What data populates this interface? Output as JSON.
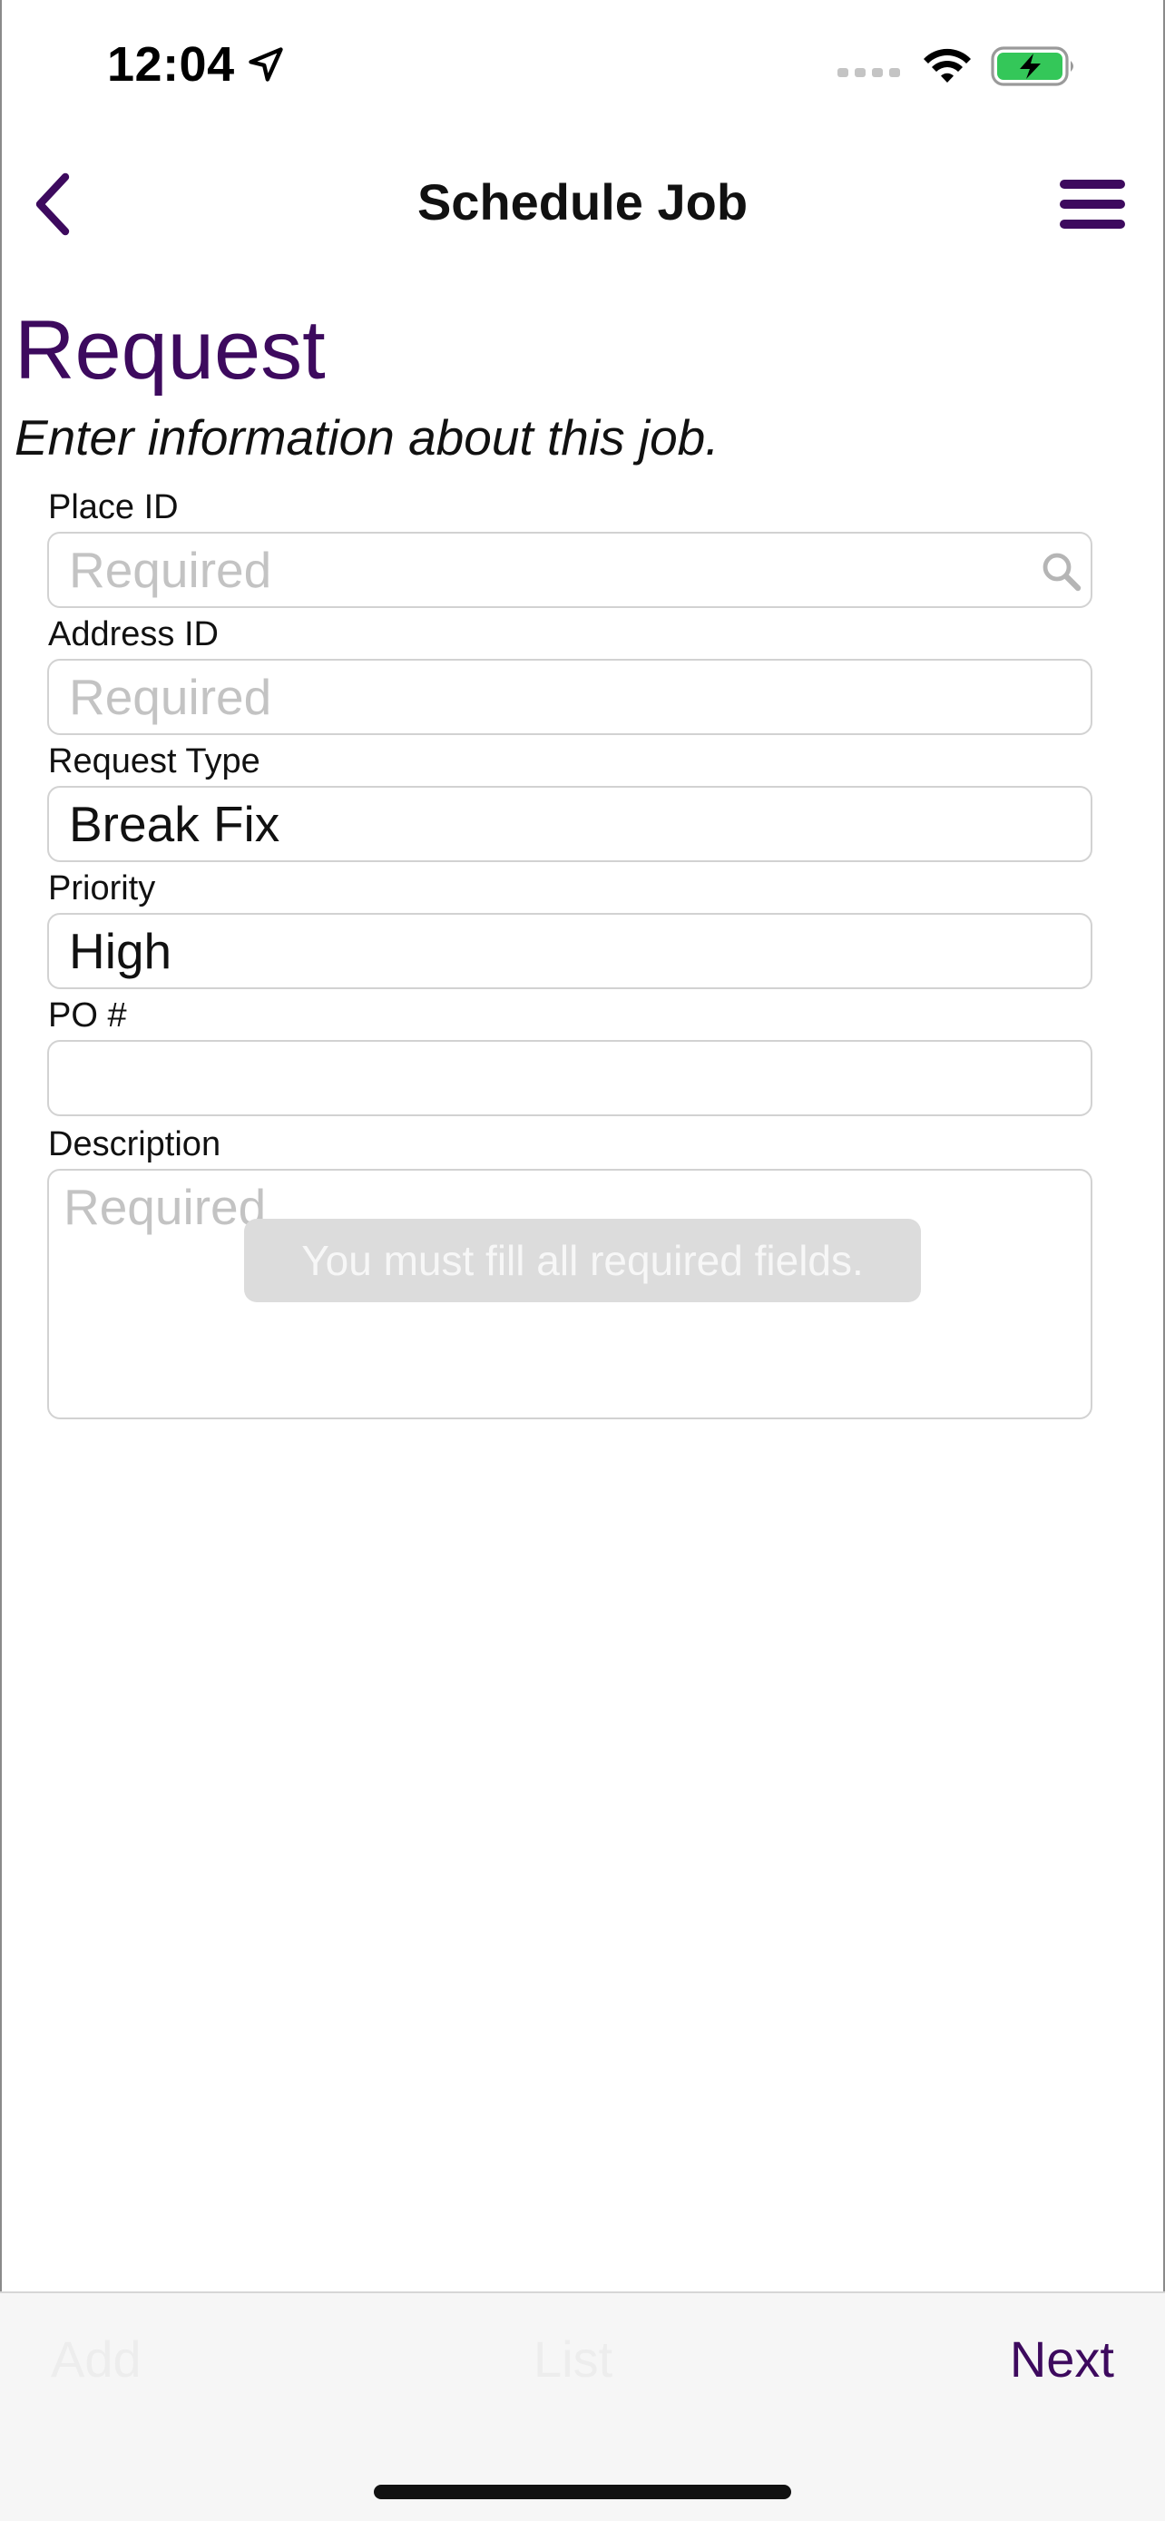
{
  "status_bar": {
    "time": "12:04",
    "icons": [
      "location-arrow-icon",
      "cellular-signal-icon",
      "wifi-icon",
      "battery-charging-icon"
    ],
    "battery_color": "#34c759"
  },
  "nav": {
    "title": "Schedule Job",
    "back_icon": "chevron-left-icon",
    "menu_icon": "hamburger-menu-icon",
    "accent_color": "#3d0a5e"
  },
  "header": {
    "heading": "Request",
    "subheading": "Enter information about this job."
  },
  "form": {
    "place_id": {
      "label": "Place ID",
      "value": "",
      "placeholder": "Required",
      "icon": "search-icon"
    },
    "address_id": {
      "label": "Address ID",
      "value": "",
      "placeholder": "Required"
    },
    "request_type": {
      "label": "Request Type",
      "value": "Break Fix"
    },
    "priority": {
      "label": "Priority",
      "value": "High"
    },
    "po_number": {
      "label": "PO #",
      "value": ""
    },
    "description": {
      "label": "Description",
      "value": "",
      "placeholder": "Required"
    }
  },
  "toast": {
    "message": "You must fill all required fields."
  },
  "toolbar": {
    "add_label": "Add",
    "list_label": "List",
    "next_label": "Next"
  }
}
